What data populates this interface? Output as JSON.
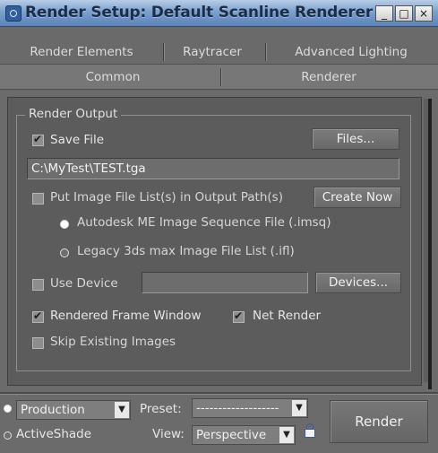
{
  "window": {
    "title": "Render Setup: Default Scanline Renderer",
    "controls": {
      "minimize": "_",
      "maximize": "□",
      "close": "×"
    }
  },
  "tabs": {
    "row1": [
      {
        "label": "Render Elements"
      },
      {
        "label": "Raytracer"
      },
      {
        "label": "Advanced Lighting"
      }
    ],
    "row2": [
      {
        "label": "Common"
      },
      {
        "label": "Renderer"
      }
    ]
  },
  "render_output": {
    "group_title": "Render Output",
    "save_file": {
      "label": "Save File",
      "checked": true
    },
    "files_button": "Files...",
    "path": "C:\\MyTest\\TEST.tga",
    "put_list": {
      "label": "Put Image File List(s) in Output Path(s)",
      "checked": false
    },
    "create_now_button": "Create Now",
    "list_options": [
      {
        "label": "Autodesk ME Image Sequence File (.imsq)",
        "selected": true
      },
      {
        "label": "Legacy 3ds max Image File List (.ifl)",
        "selected": false
      }
    ],
    "use_device": {
      "label": "Use Device",
      "checked": false
    },
    "devices_button": "Devices...",
    "rendered_frame_window": {
      "label": "Rendered Frame Window",
      "checked": true
    },
    "net_render": {
      "label": "Net Render",
      "checked": true
    },
    "skip_existing": {
      "label": "Skip Existing Images",
      "checked": false
    }
  },
  "footer": {
    "mode_production": {
      "label": "Production",
      "selected": true
    },
    "mode_activeshade": {
      "label": "ActiveShade",
      "selected": false
    },
    "mode_dropdown_value": "Production",
    "preset_label": "Preset:",
    "preset_value": "-------------------",
    "view_label": "View:",
    "view_value": "Perspective",
    "render_button": "Render"
  },
  "colors": {
    "titlebar_gradient_top": "#b8cde6",
    "titlebar_gradient_bottom": "#5a83b9",
    "background": "#6b6b6b",
    "panel": "#5c5c5c",
    "text": "#e6e6e6"
  },
  "icons": [
    "app-icon",
    "check-icon",
    "radio-icon",
    "chevron-down-icon",
    "lock-icon",
    "minimize-icon",
    "maximize-icon",
    "close-icon"
  ]
}
